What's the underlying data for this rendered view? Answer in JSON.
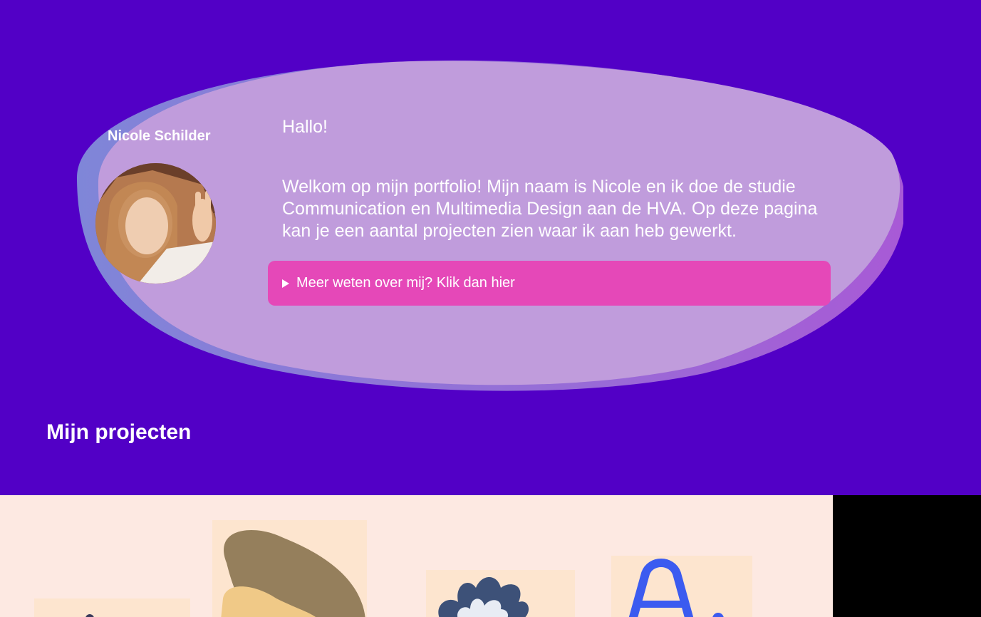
{
  "profile": {
    "name": "Nicole Schilder",
    "avatar_alt": "Nicole"
  },
  "intro": {
    "greeting": "Hallo!",
    "text": "Welkom op mijn portfolio! Mijn naam is Nicole en ik doe de studie Communication en Multimedia Design aan de HVA. Op deze pagina kan je een aantal projecten zien waar ik aan heb gewerkt.",
    "details_summary": "Meer weten over mij? Klik dan hier"
  },
  "projects": {
    "title": "Mijn projecten",
    "tiles": [
      {
        "icon": "project-thumbnail-1"
      },
      {
        "icon": "project-thumbnail-2"
      },
      {
        "icon": "project-thumbnail-3"
      },
      {
        "icon": "project-thumbnail-4"
      },
      {
        "icon": "project-thumbnail-5"
      }
    ]
  },
  "colors": {
    "background": "#5200c6",
    "bubble": "#c09cdc",
    "button": "#e548b8",
    "strip": "#fde9e2"
  }
}
